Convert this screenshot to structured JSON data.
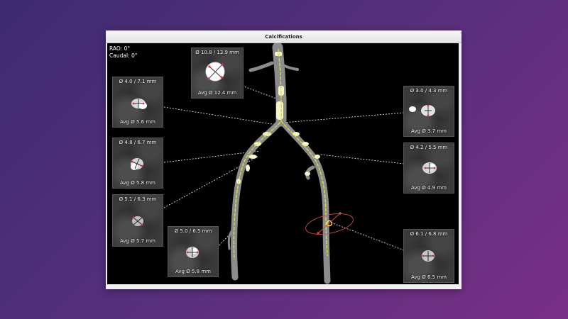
{
  "window": {
    "title": "Calcifications"
  },
  "orientation": {
    "rao": "RAO: 0°",
    "caudal": "Caudal: 0°"
  },
  "thumbnails": [
    {
      "diameter": "Ø 10.8 / 13.9 mm",
      "avg": "Avg Ø 12.4 mm"
    },
    {
      "diameter": "Ø 4.0 / 7.1 mm",
      "avg": "Avg Ø 5.6 mm"
    },
    {
      "diameter": "Ø 4.8 / 6.7 mm",
      "avg": "Avg Ø 5.8 mm"
    },
    {
      "diameter": "Ø 5.1 / 6.3 mm",
      "avg": "Avg Ø 5.7 mm"
    },
    {
      "diameter": "Ø 5.0 / 6.5 mm",
      "avg": "Avg Ø 5.8 mm"
    },
    {
      "diameter": "Ø 3.0 / 4.3 mm",
      "avg": "Avg Ø 3.7 mm"
    },
    {
      "diameter": "Ø 4.2 / 5.5 mm",
      "avg": "Avg Ø 4.9 mm"
    },
    {
      "diameter": "Ø 6.1 / 6.8 mm",
      "avg": "Avg Ø 6.5 mm"
    }
  ],
  "colors": {
    "centerline": "#d8d84a",
    "calcification": "#f4f4c8",
    "measure": "#e0303a",
    "vessel": "#8c8c8c"
  }
}
